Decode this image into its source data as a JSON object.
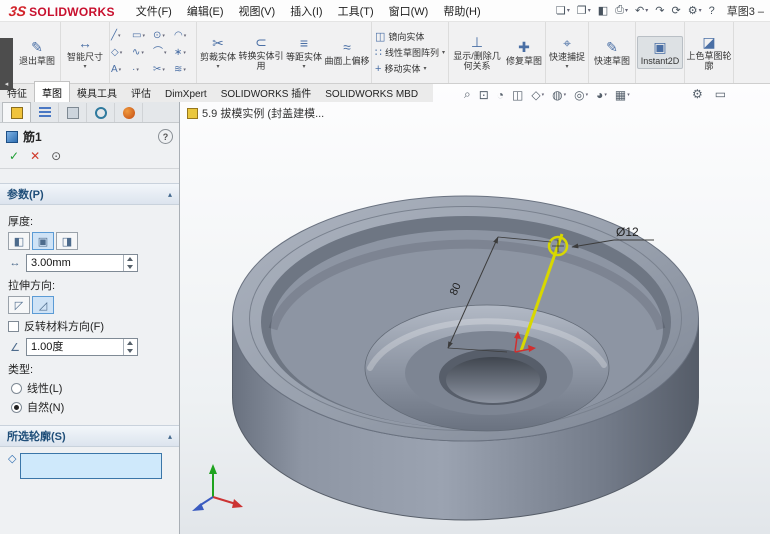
{
  "titlebar": {
    "logo_mark": "3S",
    "logo_text": "SOLIDWORKS",
    "menus": [
      "文件(F)",
      "编辑(E)",
      "视图(V)",
      "插入(I)",
      "工具(T)",
      "窗口(W)",
      "帮助(H)"
    ],
    "glyphs": [
      "❏",
      "❐",
      "◧",
      "⎙",
      "↶",
      "↷",
      "⟳",
      "⚙",
      "?"
    ],
    "doc_title": "草图3 –"
  },
  "ribbon": {
    "buttons": [
      {
        "label": "退出草图",
        "glyph": "✎"
      },
      {
        "label": "智能尺寸",
        "glyph": "↔"
      },
      {
        "label": "剪裁实体",
        "glyph": "✂"
      },
      {
        "label": "转换实体引用",
        "glyph": "⊂"
      },
      {
        "label": "等距实体",
        "glyph": "≡"
      },
      {
        "label": "曲面上偏移",
        "glyph": "≈"
      },
      {
        "label": "镜向实体",
        "glyph": "◫"
      },
      {
        "label": "线性草图阵列",
        "glyph": "∷"
      },
      {
        "label": "移动实体",
        "glyph": "+"
      },
      {
        "label": "显示/删除几何关系",
        "glyph": "⊥"
      },
      {
        "label": "修复草图",
        "glyph": "✚"
      },
      {
        "label": "快速捕捉",
        "glyph": "⌖"
      },
      {
        "label": "快速草图",
        "glyph": "✎"
      },
      {
        "label": "Instant2D",
        "glyph": "▣"
      },
      {
        "label": "上色草图轮廓",
        "glyph": "◪"
      }
    ],
    "sketch_glyphs": [
      "╱",
      "▭",
      "⊙",
      "◠",
      "◇",
      "∿",
      "⌒",
      "∗",
      "A",
      "·",
      "✂",
      "≋"
    ]
  },
  "tabs": [
    "特征",
    "草图",
    "模具工具",
    "评估",
    "DimXpert",
    "SOLIDWORKS 插件",
    "SOLIDWORKS MBD"
  ],
  "headsup": [
    "⌕",
    "⊡",
    "◔",
    "◫",
    "◇",
    "◍",
    "◎",
    "◕",
    "▦"
  ],
  "headsup_right": [
    "⚙",
    "▭"
  ],
  "icons": {
    "caret": "▾",
    "chevron": "▴",
    "check": "✓",
    "cancel": "✕",
    "preview": "⊙",
    "help": "?",
    "diamond": "◇",
    "thickness_first": "◧",
    "thickness_both": "▣",
    "thickness_second": "◨",
    "direction_one": "◸",
    "direction_two": "◿",
    "thickness_param": "↔",
    "draft_param": "∠",
    "collapse_arrow": "◂"
  },
  "panel": {
    "title": "筋1",
    "params_header": "参数(P)",
    "thickness_label": "厚度:",
    "thickness_value": "3.00mm",
    "direction_label": "拉伸方向:",
    "flip_material": "反转材料方向(F)",
    "draft_value": "1.00度",
    "type_label": "类型:",
    "type_linear": "线性(L)",
    "type_natural": "自然(N)",
    "contours_header": "所选轮廓(S)"
  },
  "viewport": {
    "doc_label": "5.9 拔模实例 (封盖建模...",
    "dim_length": "80",
    "dim_diameter": "Ø12"
  }
}
